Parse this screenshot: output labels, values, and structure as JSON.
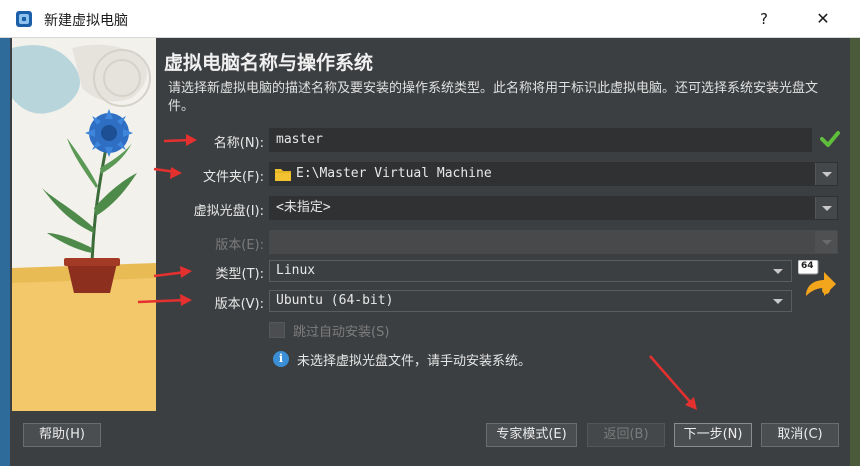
{
  "window": {
    "title": "新建虚拟电脑",
    "help_label": "?",
    "close_label": "✕"
  },
  "page": {
    "heading": "虚拟电脑名称与操作系统",
    "description": "请选择新虚拟电脑的描述名称及要安装的操作系统类型。此名称将用于标识此虚拟电脑。还可选择系统安装光盘文件。"
  },
  "form": {
    "name_label": "名称(N):",
    "name_value": "master",
    "folder_label": "文件夹(F):",
    "folder_value": "E:\\Master Virtual Machine",
    "iso_label": "虚拟光盘(I):",
    "iso_value": "<未指定>",
    "edition_label": "版本(E):",
    "edition_value": "",
    "type_label": "类型(T):",
    "type_value": "Linux",
    "version_label": "版本(V):",
    "version_value": "Ubuntu (64-bit)",
    "os_badge": "64",
    "unattended_label": "跳过自动安装(S)",
    "info_text": "未选择虚拟光盘文件，请手动安装系统。"
  },
  "buttons": {
    "help": "帮助(H)",
    "expert": "专家模式(E)",
    "back": "返回(B)",
    "next": "下一步(N)",
    "cancel": "取消(C)"
  },
  "colors": {
    "accent": "#3b8fd6",
    "annotation_arrow": "#e53030",
    "valid_check": "#5fbf3c",
    "folder_icon": "#f2c230"
  }
}
